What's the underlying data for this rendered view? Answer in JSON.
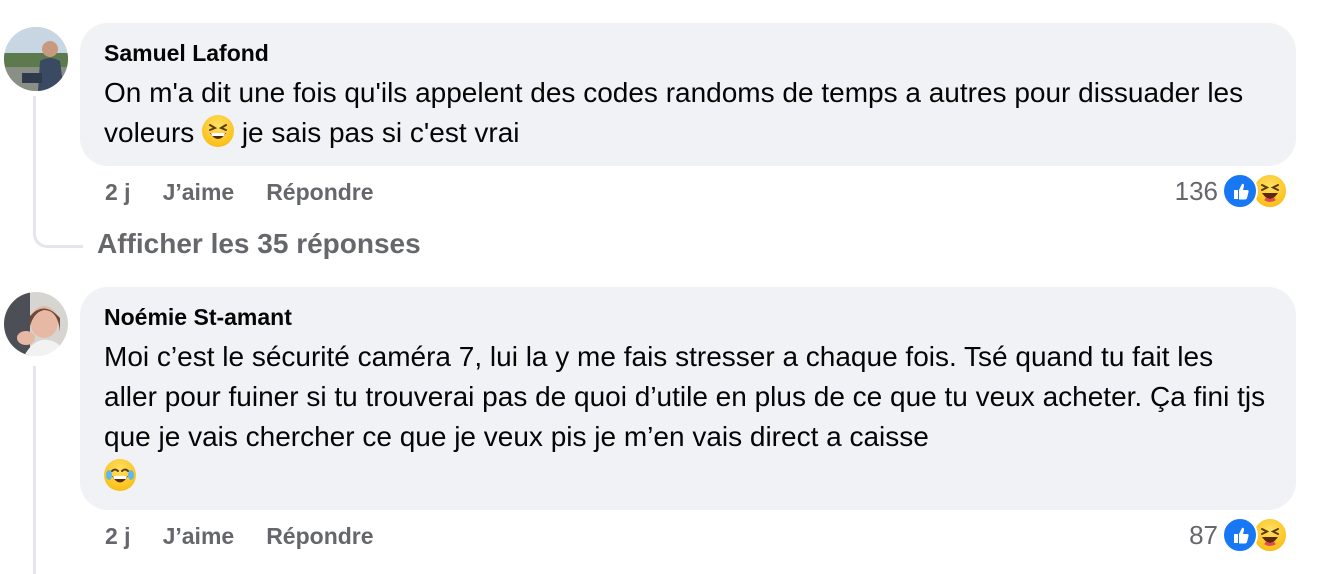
{
  "comments": [
    {
      "author": "Samuel Lafond",
      "text_before_emoji": "On m'a dit une fois qu'ils appelent des codes randoms de temps a autres pour dissuader les voleurs ",
      "emoji": "grinning-squinting-face-emoji",
      "text_after_emoji": " je sais pas si c'est vrai",
      "time": "2 j",
      "like_label": "J’aime",
      "reply_label": "Répondre",
      "reaction_count": "136",
      "reactions": [
        "like-icon",
        "haha-icon"
      ]
    },
    {
      "author": "Noémie St-amant",
      "text": "Moi c’est le sécurité caméra 7, lui la y me fais stresser a chaque fois. Tsé quand tu fait les aller pour fuiner si tu trouverai pas de quoi d’utile en plus de ce que tu veux acheter. Ça fini tjs que je vais chercher ce que je veux pis je m’en vais direct a caisse",
      "emoji": "laughing-tears-emoji",
      "time": "2 j",
      "like_label": "J’aime",
      "reply_label": "Répondre",
      "reaction_count": "87",
      "reactions": [
        "like-icon",
        "haha-icon"
      ]
    }
  ],
  "show_replies_label": "Afficher les 35 réponses",
  "colors": {
    "bubble": "#f0f2f5",
    "secondary_text": "#65676b",
    "like_blue": "#1877f2",
    "emoji_yellow": "#fcc21b"
  }
}
